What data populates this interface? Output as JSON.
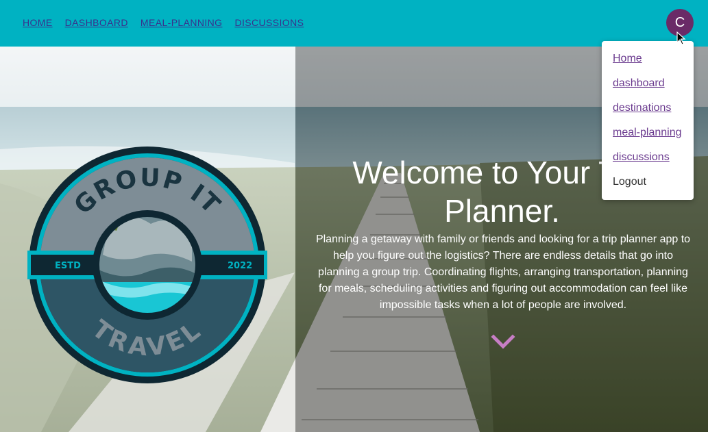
{
  "nav": {
    "links": [
      "HOME",
      "DASHBOARD",
      "MEAL-PLANNING",
      "DISCUSSIONS"
    ],
    "avatar_initial": "C"
  },
  "dropdown": {
    "items": [
      "Home",
      "dashboard",
      "destinations",
      "meal-planning",
      "discussions"
    ],
    "logout": "Logout"
  },
  "logo": {
    "top_text": "GROUP IT",
    "bottom_text": "TRAVEL",
    "estd_label": "ESTD",
    "year": "2022"
  },
  "hero": {
    "title": "Welcome to Your Trip Planner.",
    "description": "Planning a getaway with family or friends and looking for a trip planner app to help you figure out the logistics? There are endless details that go into planning a group trip. Coordinating flights, arranging transportation, planning for meals, scheduling activities and figuring out accommodation can feel like impossible tasks when a lot of people are involved."
  },
  "icons": {
    "scroll_down": "chevron-down-icon",
    "cursor": "mouse-pointer-icon"
  },
  "colors": {
    "navbar": "#00b2c2",
    "avatar": "#6a2b67",
    "chevron": "#c77ec5",
    "link": "#6b3b8f"
  }
}
